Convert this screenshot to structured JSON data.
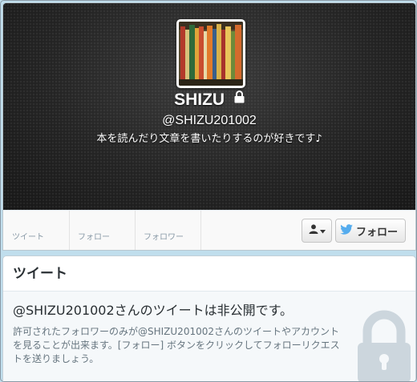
{
  "profile": {
    "display_name": "SHIZU",
    "handle": "@SHIZU201002",
    "bio": "本を読んだり文章を書いたりするのが好きです♪",
    "protected": true
  },
  "stats": [
    {
      "label": "ツイート"
    },
    {
      "label": "フォロー"
    },
    {
      "label": "フォロワー"
    }
  ],
  "actions": {
    "user_menu_icon": "user-icon",
    "follow_label": "フォロー",
    "follow_icon": "bird-icon"
  },
  "tweets": {
    "heading": "ツイート",
    "protected_title": "@SHIZU201002さんのツイートは非公開です。",
    "protected_text": "許可されたフォロワーのみが@SHIZU201002さんのツイートやアカウントを見ることが出来ます。[フォロー] ボタンをクリックしてフォローリクエストを送りましょう。"
  },
  "colors": {
    "background": "#c0deed",
    "header": "#262626",
    "bird": "#55acee",
    "text_dark": "#292f33",
    "text_muted": "#66757f"
  }
}
